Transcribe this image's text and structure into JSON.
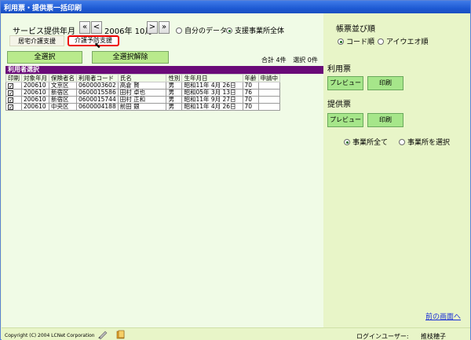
{
  "window": {
    "title": "利用票・提供票一括印刷"
  },
  "period": {
    "label": "サービス提供年月",
    "first_label": "«",
    "prev_label": "<",
    "year": "2006年",
    "month": "10月",
    "next_label": ">",
    "last_label": "»"
  },
  "scope": {
    "own": "自分のデータ",
    "office_all": "支援事業所全体",
    "selected": "office_all"
  },
  "tabs": {
    "home_care": "居宅介護支援",
    "prevention": "介護予防支援"
  },
  "buttons": {
    "select_all": "全選択",
    "clear_all": "全選択解除"
  },
  "counts": {
    "total": "合計 4件",
    "selected": "選択 0件"
  },
  "section": {
    "title": "利用者選択"
  },
  "table": {
    "headers": [
      "印刷",
      "対象年月",
      "保険者名",
      "利用者コード",
      "氏名",
      "性別",
      "生年月日",
      "年齢",
      "申請中"
    ],
    "rows": [
      {
        "print": "✓",
        "ym": "200610",
        "insurer": "文京区",
        "code": "0600003602",
        "name": "高倉  賢",
        "sex": "男",
        "dob": "昭和11年 4月 26日",
        "age": "70",
        "pending": ""
      },
      {
        "print": "✓",
        "ym": "200610",
        "insurer": "新宿区",
        "code": "0600015586",
        "name": "田村  卓也",
        "sex": "男",
        "dob": "昭和05年 3月 13日",
        "age": "76",
        "pending": ""
      },
      {
        "print": "✓",
        "ym": "200610",
        "insurer": "新宿区",
        "code": "0600015744",
        "name": "田村  正和",
        "sex": "男",
        "dob": "昭和11年 9月 27日",
        "age": "70",
        "pending": ""
      },
      {
        "print": "✓",
        "ym": "200610",
        "insurer": "中央区",
        "code": "0600004188",
        "name": "前田  銀",
        "sex": "男",
        "dob": "昭和11年 4月 26日",
        "age": "70",
        "pending": ""
      }
    ]
  },
  "right": {
    "sort_label": "帳票並び順",
    "sort_code": "コード順",
    "sort_kana": "アイウエオ順",
    "usage_label": "利用票",
    "provide_label": "提供票",
    "preview": "プレビュー",
    "print": "印刷",
    "office_all": "事業所全て",
    "office_select": "事業所を選択",
    "back": "前の画面へ"
  },
  "status": {
    "copyright": "Copyright (C) 2004 LCNet Corporation",
    "login_label": "ログインユーザー:",
    "login_user": "推枝穂子"
  },
  "icons": {
    "pen": "pen-icon",
    "book": "book-icon"
  }
}
